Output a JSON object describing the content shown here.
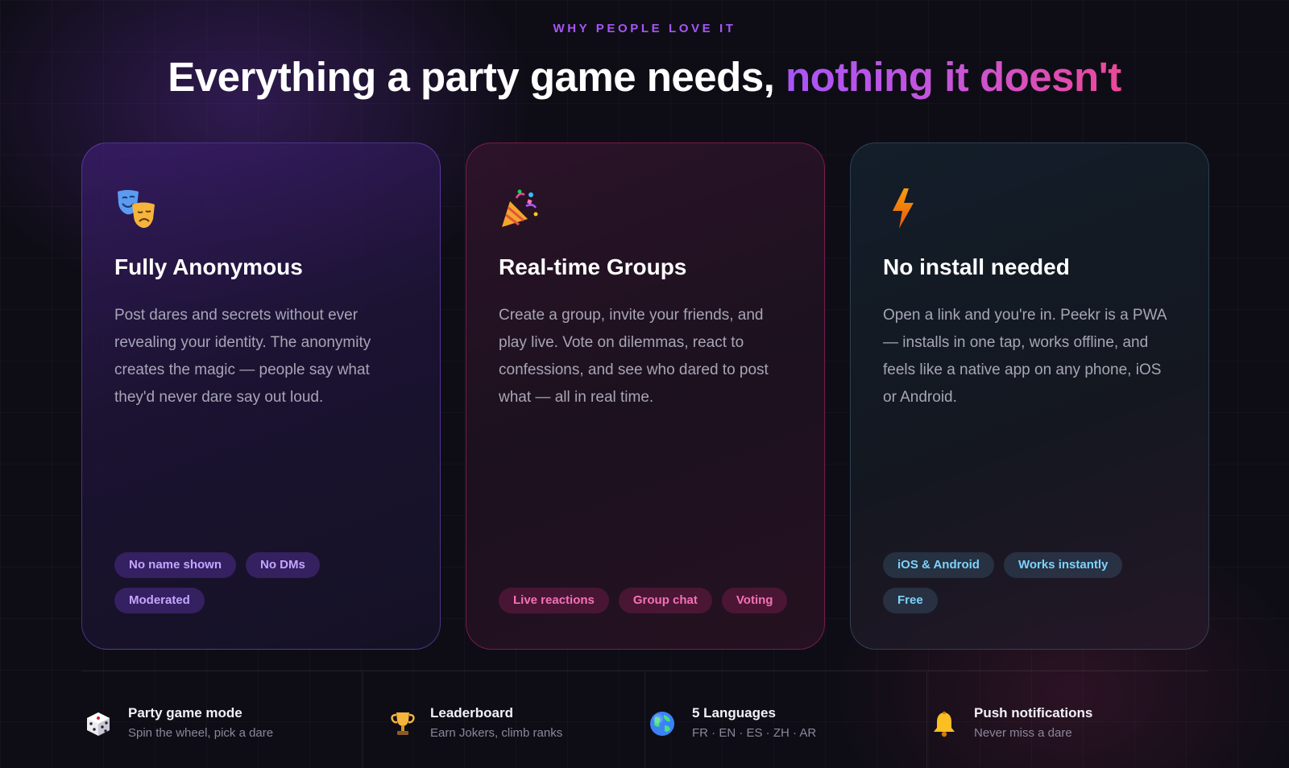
{
  "section": {
    "eyebrow": "WHY PEOPLE LOVE IT",
    "headline_main": "Everything a party game needs, ",
    "headline_accent": "nothing it doesn't"
  },
  "cards": [
    {
      "icon": "theater-masks-icon",
      "title": "Fully Anonymous",
      "description": "Post dares and secrets without ever revealing your identity. The anonymity creates the magic — people say what they'd never dare say out loud.",
      "chips": [
        "No name shown",
        "No DMs",
        "Moderated"
      ]
    },
    {
      "icon": "party-popper-icon",
      "title": "Real-time Groups",
      "description": "Create a group, invite your friends, and play live. Vote on dilemmas, react to confessions, and see who dared to post what — all in real time.",
      "chips": [
        "Live reactions",
        "Group chat",
        "Voting"
      ]
    },
    {
      "icon": "lightning-bolt-icon",
      "title": "No install needed",
      "description": "Open a link and you're in. Peekr is a PWA — installs in one tap, works offline, and feels like a native app on any phone, iOS or Android.",
      "chips": [
        "iOS & Android",
        "Works instantly",
        "Free"
      ]
    }
  ],
  "features": [
    {
      "icon": "dice-icon",
      "title": "Party game mode",
      "subtitle": "Spin the wheel, pick a dare"
    },
    {
      "icon": "trophy-icon",
      "title": "Leaderboard",
      "subtitle": "Earn Jokers, climb ranks"
    },
    {
      "icon": "globe-icon",
      "title": "5 Languages",
      "subtitle": "FR · EN · ES · ZH · AR"
    },
    {
      "icon": "bell-icon",
      "title": "Push notifications",
      "subtitle": "Never miss a dare"
    }
  ],
  "colors": {
    "background": "#0e0d15",
    "accent_purple": "#a855f7",
    "accent_pink": "#ec4899",
    "accent_cyan": "#7dd3fc"
  }
}
